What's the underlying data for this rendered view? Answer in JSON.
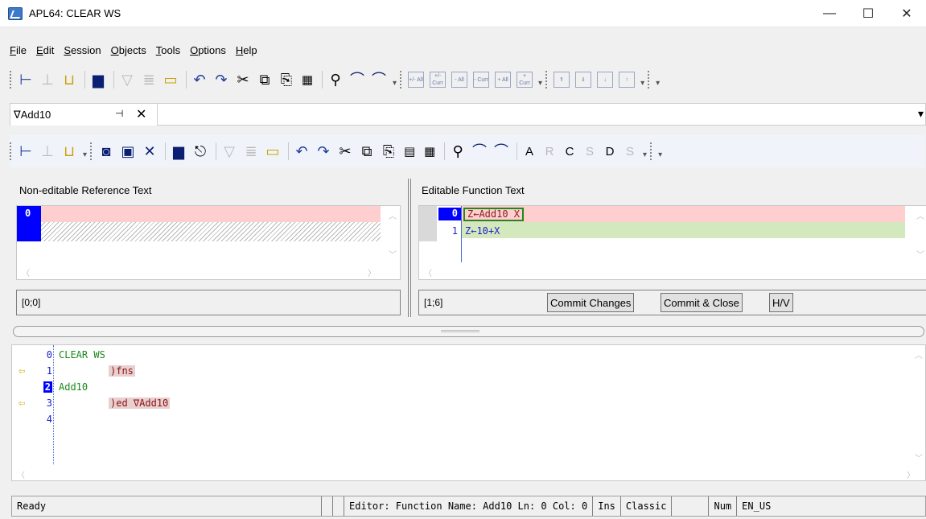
{
  "window": {
    "title": "APL64: CLEAR WS",
    "minimize": "—",
    "maximize": "☐",
    "close": "✕"
  },
  "menu": [
    {
      "first": "F",
      "rest": "ile"
    },
    {
      "first": "E",
      "rest": "dit"
    },
    {
      "first": "S",
      "rest": "ession"
    },
    {
      "first": "O",
      "rest": "bjects"
    },
    {
      "first": "T",
      "rest": "ools"
    },
    {
      "first": "O",
      "rest": "ptions"
    },
    {
      "first": "H",
      "rest": "elp"
    }
  ],
  "toolbar_icons": {
    "session_toolbar": [
      "dock-left-icon",
      "dock-bottom-icon",
      "dock-float-icon",
      "print-icon",
      "filter-icon",
      "list-icon",
      "open-folder-icon",
      "undo-icon",
      "redo-icon",
      "cut-icon",
      "copy-icon",
      "paste-icon",
      "select-all-icon",
      "find-icon",
      "find-next-icon",
      "find-prev-icon"
    ],
    "session_box_icons": [
      "+/-\nAll",
      "+/-\nCurr",
      "-\nAll",
      "-\nCurr",
      "+\nAll",
      "+\nCurr"
    ]
  },
  "tab": {
    "label": "∇Add10",
    "pin": "⊣",
    "close": "✕",
    "menu": "▾"
  },
  "editor_toolbar": {
    "circle_labels": [
      "R",
      "C",
      "S",
      "D",
      "S"
    ],
    "alpha": "A"
  },
  "reference_pane": {
    "label": "Non-editable Reference Text",
    "line_number": "0",
    "position": "[0;0]"
  },
  "edit_pane": {
    "label": "Editable Function Text",
    "lines": [
      {
        "num": "0",
        "text": "Z←Add10 X"
      },
      {
        "num": "1",
        "text": "Z←10+X"
      }
    ],
    "position": "[1;6]",
    "commit_label": "Commit Changes",
    "commit_close_label": "Commit & Close",
    "hv_label": "H/V"
  },
  "session": {
    "lines": [
      {
        "num": "0",
        "text": "CLEAR WS",
        "kind": "output",
        "bang": false
      },
      {
        "num": "1",
        "text": ")fns",
        "kind": "input",
        "bang": true
      },
      {
        "num": "2",
        "text": "Add10",
        "kind": "output",
        "bang": false,
        "selected": true
      },
      {
        "num": "3",
        "text": ")ed ∇Add10",
        "kind": "input",
        "bang": true
      },
      {
        "num": "4",
        "text": "",
        "kind": "empty",
        "bang": false
      }
    ]
  },
  "statusbar": {
    "ready": "Ready",
    "editor_info": "Editor: Function Name: Add10 Ln: 0 Col: 0",
    "mode": "Ins",
    "keyboard": "Classic",
    "num": "Num",
    "locale": "EN_US"
  }
}
